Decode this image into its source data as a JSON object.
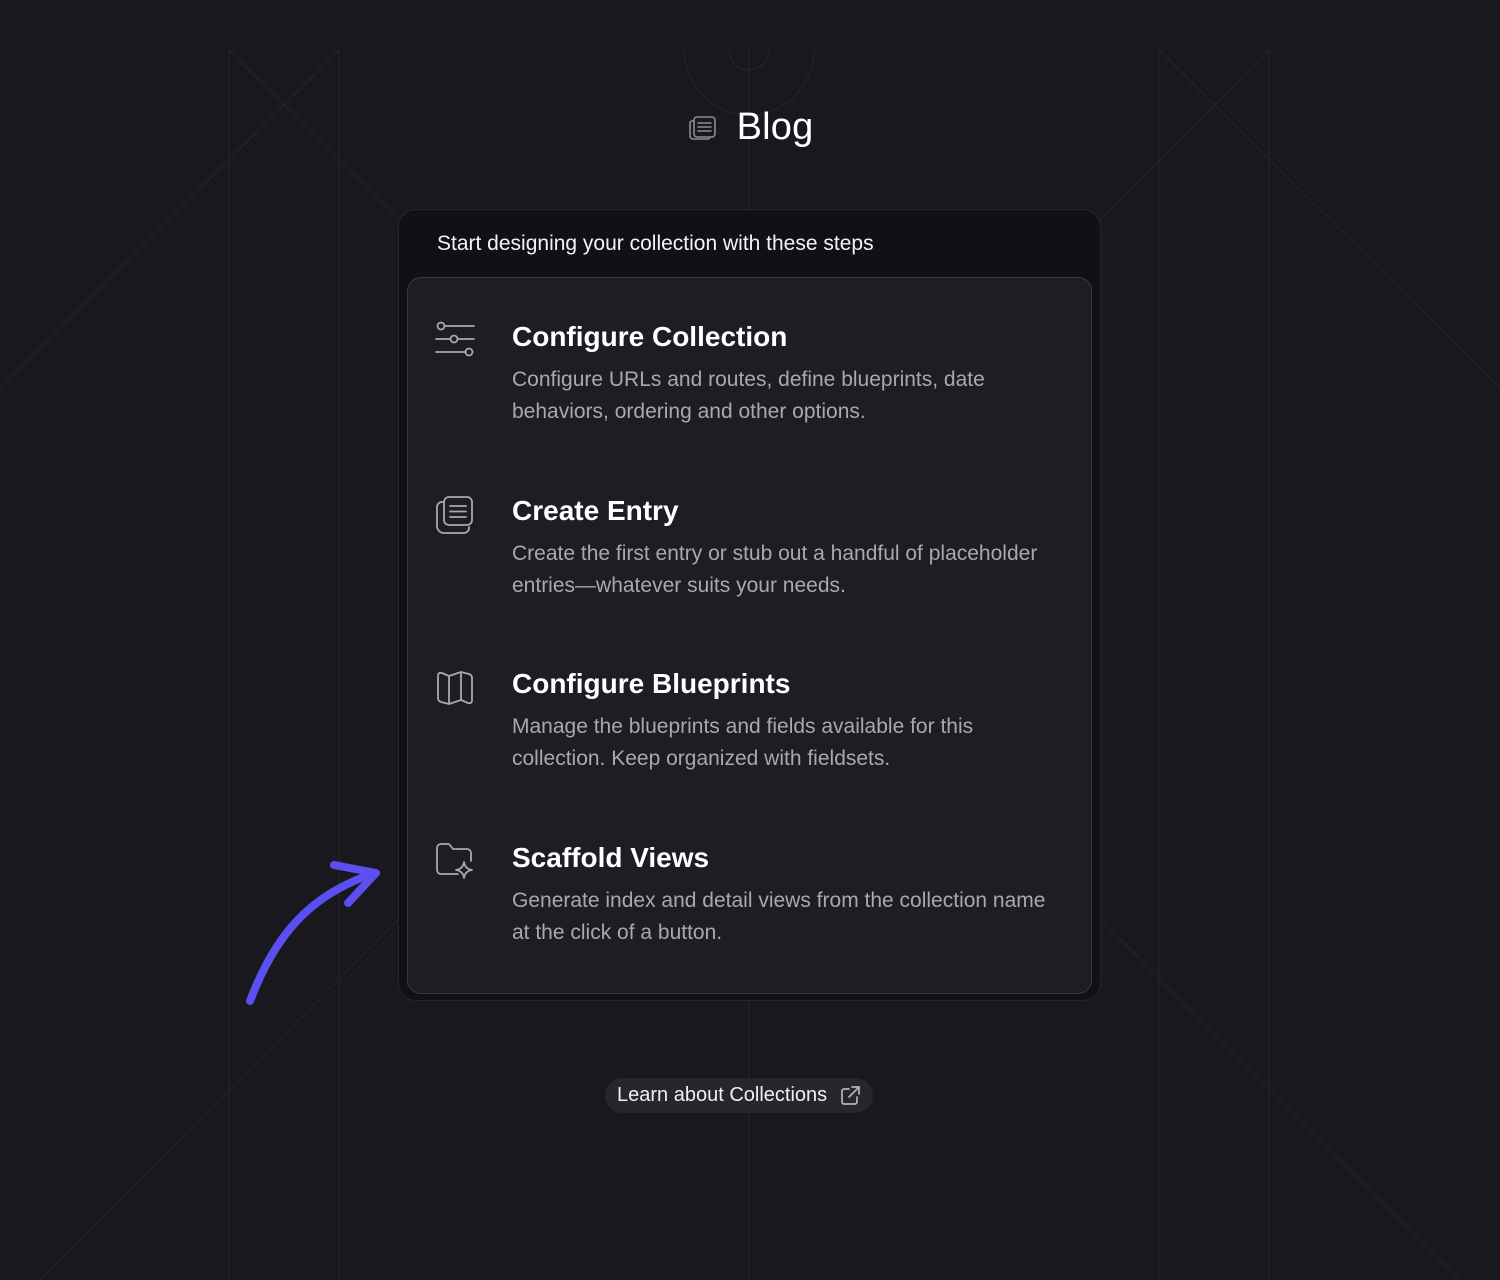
{
  "header": {
    "title": "Blog",
    "icon": "collection-icon"
  },
  "card": {
    "intro": "Start designing your collection with these steps",
    "steps": [
      {
        "icon": "sliders-icon",
        "title": "Configure Collection",
        "description": "Configure URLs and routes, define blueprints, date behaviors, ordering and other options."
      },
      {
        "icon": "entries-icon",
        "title": "Create Entry",
        "description": "Create the first entry or stub out a handful of placeholder entries—whatever suits your needs."
      },
      {
        "icon": "map-icon",
        "title": "Configure Blueprints",
        "description": "Manage the blueprints and fields available for this collection. Keep organized with fieldsets."
      },
      {
        "icon": "folder-sparkle-icon",
        "title": "Scaffold Views",
        "description": "Generate index and detail views from the collection name at the click of a button."
      }
    ]
  },
  "footer": {
    "learn_label": "Learn about Collections",
    "learn_icon": "external-link-icon"
  },
  "colors": {
    "background": "#19181e",
    "card_outer": "#111115",
    "card_inner": "#1e1d23",
    "arrow": "#5a4ff0"
  }
}
